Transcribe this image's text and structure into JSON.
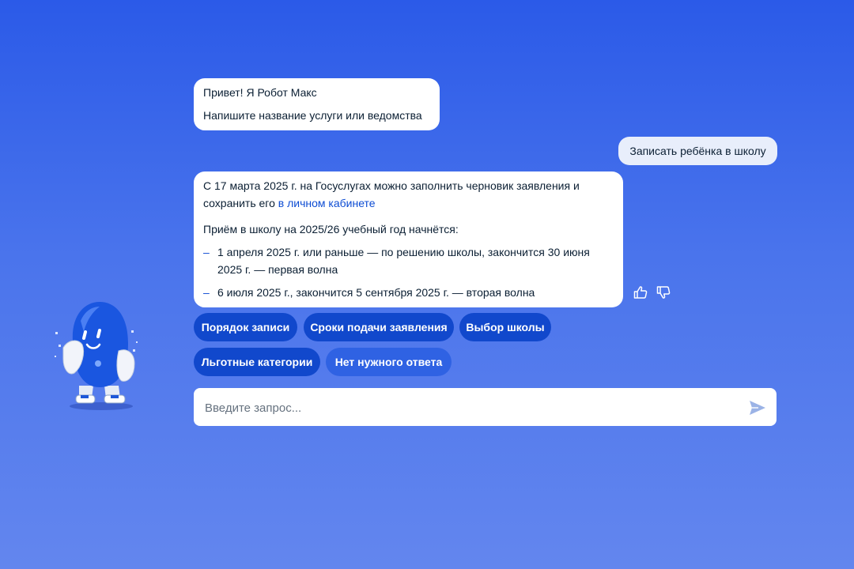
{
  "chat": {
    "greeting": {
      "line1": "Привет! Я Робот Макс",
      "line2": "Напишите название услуги или ведомства"
    },
    "user_message": "Записать ребёнка в школу",
    "answer": {
      "p1_text": "С 17 марта 2025 г. на Госуслугах можно заполнить черновик заявления и сохранить его",
      "p1_link": "в личном кабинете",
      "p2_text": "Приём в школу на 2025/26 учебный год начнётся:",
      "list": [
        "1 апреля 2025 г. или раньше — по решению школы, закончится 30 июня 2025 г. — первая волна",
        "6 июля 2025 г., закончится 5 сентября 2025 г. — вторая волна"
      ],
      "list_marker": "–"
    },
    "feedback": {
      "like_icon": "thumbs-up-icon",
      "dislike_icon": "thumbs-down-icon"
    }
  },
  "quick_replies": [
    "Порядок записи",
    "Сроки подачи заявления",
    "Выбор школы",
    "Льготные категории",
    "Нет нужного ответа"
  ],
  "input": {
    "placeholder": "Введите запрос...",
    "value": "",
    "send_icon": "send-icon"
  },
  "assistant": {
    "avatar_icon": "robot-max-mascot"
  },
  "colors": {
    "background_top": "#2b5ae8",
    "background_bottom": "#6386ee",
    "chip_primary": "#1148cc",
    "chip_secondary": "#2f62e3",
    "link": "#0d4cd3",
    "user_bubble": "#e8eefb"
  }
}
